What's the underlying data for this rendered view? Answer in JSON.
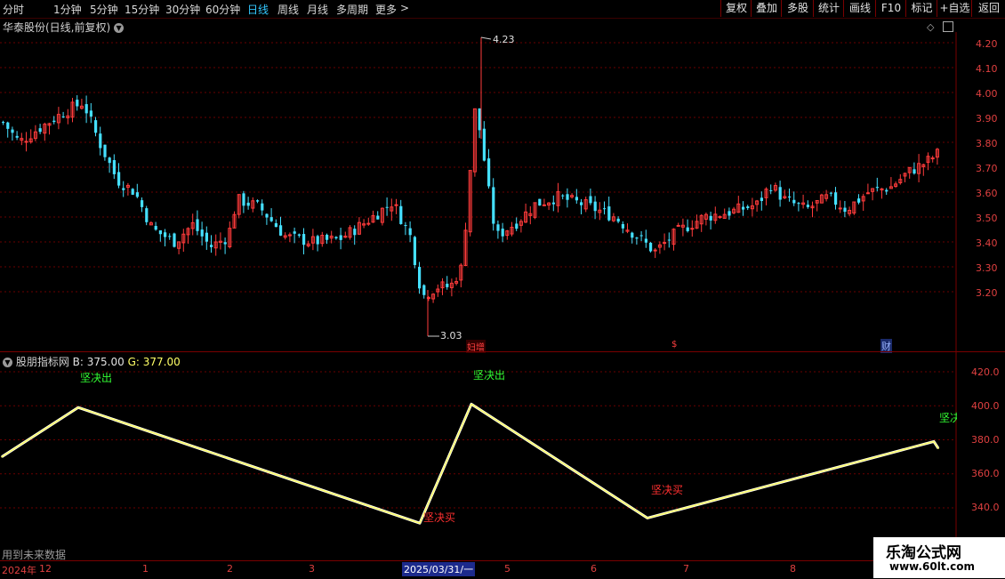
{
  "toolbar": {
    "periods": [
      "分时",
      "1分钟",
      "5分钟",
      "15分钟",
      "30分钟",
      "60分钟",
      "日线",
      "周线",
      "月线",
      "多周期",
      "更多"
    ],
    "active_period": "日线",
    "more_arrow": ">",
    "buttons": [
      "复权",
      "叠加",
      "多股",
      "统计",
      "画线",
      "F10",
      "标记",
      "+自选",
      "返回"
    ]
  },
  "main_chart": {
    "title": "华泰股份(日线,前复权)",
    "high_label": "4.23",
    "low_label": "3.03",
    "y_ticks": [
      "4.20",
      "4.10",
      "4.00",
      "3.90",
      "3.80",
      "3.70",
      "3.60",
      "3.50",
      "3.40",
      "3.30",
      "3.20"
    ],
    "markers": [
      {
        "text": "妇增",
        "color": "#ff4040"
      },
      {
        "text": "$",
        "color": "#ff4040"
      },
      {
        "text": "财",
        "color": "#4a7cff"
      }
    ]
  },
  "indicator": {
    "name": "股朋指标网",
    "b_label": "B: 375.00",
    "g_label": "G: 377.00",
    "y_ticks": [
      "420.0",
      "400.0",
      "380.0",
      "360.0",
      "340.0"
    ],
    "signals": [
      {
        "text": "坚决出",
        "color": "#33ff33"
      },
      {
        "text": "坚决出",
        "color": "#33ff33"
      },
      {
        "text": "坚决",
        "color": "#33ff33"
      },
      {
        "text": "坚决买",
        "color": "#ff3030"
      },
      {
        "text": "坚决买",
        "color": "#ff3030"
      }
    ],
    "future_note": "用到未来数据",
    "line_color": "#ffff66"
  },
  "date_axis": {
    "ticks": [
      "2024年",
      "12",
      "1",
      "2",
      "3",
      "5",
      "6",
      "7",
      "8"
    ],
    "cursor_date": "2025/03/31/一"
  },
  "watermark": {
    "title": "乐淘公式网",
    "url": "www.60lt.com"
  },
  "chart_data": {
    "type": "line",
    "title": "股朋指标网",
    "series": [
      {
        "name": "B",
        "values": [
          370,
          399,
          331,
          401,
          334,
          379,
          375
        ]
      }
    ],
    "ylim": [
      330,
      425
    ],
    "ylabel": "",
    "xlabel": ""
  }
}
